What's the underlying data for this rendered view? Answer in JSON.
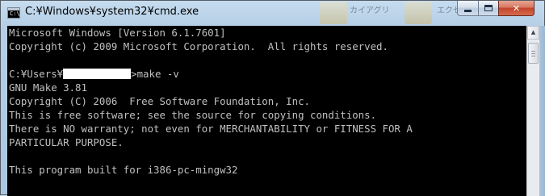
{
  "window": {
    "title": "C:¥Windows¥system32¥cmd.exe",
    "icon": "cmd-window-icon",
    "icon_glyph": "C:\\",
    "controls": {
      "minimize_icon": "minimize-icon",
      "maximize_icon": "maximize-icon",
      "close_icon": "close-icon",
      "close_glyph": "✕"
    },
    "background_hint": [
      "カイアグリ",
      "エクセル"
    ]
  },
  "console": {
    "colors": {
      "background": "#000000",
      "foreground": "#c0c0c0"
    },
    "lines": [
      "Microsoft Windows [Version 6.1.7601]",
      "Copyright (c) 2009 Microsoft Corporation.  All rights reserved.",
      "",
      "",
      "GNU Make 3.81",
      "Copyright (C) 2006  Free Software Foundation, Inc.",
      "This is free software; see the source for copying conditions.",
      "There is NO warranty; not even for MERCHANTABILITY or FITNESS FOR A",
      "PARTICULAR PURPOSE.",
      "",
      "This program built for i386-pc-mingw32"
    ],
    "prompt": {
      "prefix": "C:¥Users¥",
      "redacted": true,
      "command": ">make -v"
    }
  },
  "scrollbar": {
    "up_arrow": "▲"
  }
}
